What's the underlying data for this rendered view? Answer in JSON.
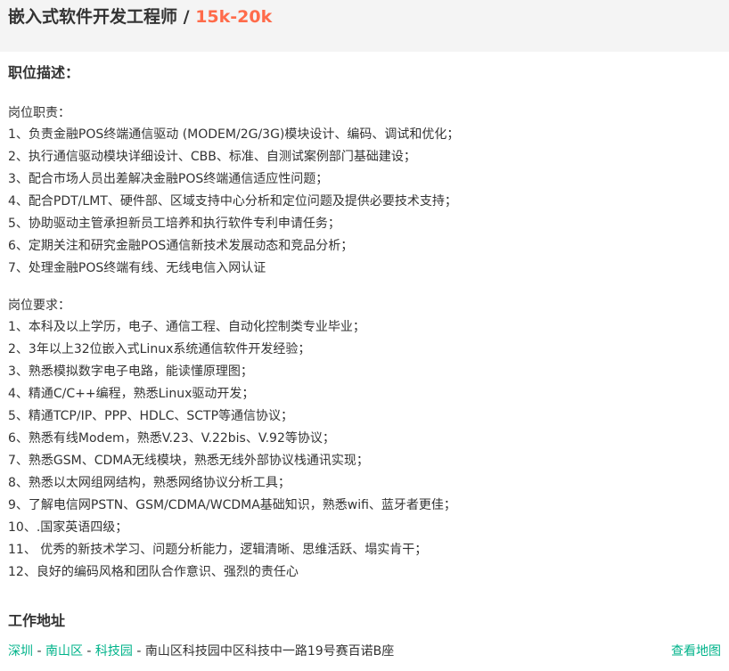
{
  "header": {
    "title": "嵌入式软件开发工程师",
    "separator": " / ",
    "salary": "15k-20k"
  },
  "description": {
    "heading": "职位描述：",
    "duties_label": "岗位职责：",
    "duties": [
      "1、负责金融POS终端通信驱动 (MODEM/2G/3G)模块设计、编码、调试和优化；",
      "2、执行通信驱动模块详细设计、CBB、标准、自测试案例部门基础建设；",
      "3、配合市场人员出差解决金融POS终端通信适应性问题；",
      "4、配合PDT/LMT、硬件部、区域支持中心分析和定位问题及提供必要技术支持；",
      "5、协助驱动主管承担新员工培养和执行软件专利申请任务；",
      "6、定期关注和研究金融POS通信新技术发展动态和竞品分析；",
      "7、处理金融POS终端有线、无线电信入网认证"
    ],
    "requirements_label": "岗位要求：",
    "requirements": [
      "1、本科及以上学历，电子、通信工程、自动化控制类专业毕业；",
      "2、3年以上32位嵌入式Linux系统通信软件开发经验；",
      "3、熟悉模拟数字电子电路，能读懂原理图；",
      "4、精通C/C++编程，熟悉Linux驱动开发；",
      "5、精通TCP/IP、PPP、HDLC、SCTP等通信协议；",
      "6、熟悉有线Modem，熟悉V.23、V.22bis、V.92等协议；",
      "7、熟悉GSM、CDMA无线模块，熟悉无线外部协议栈通讯实现；",
      "8、熟悉以太网组网结构，熟悉网络协议分析工具；",
      "9、了解电信网PSTN、GSM/CDMA/WCDMA基础知识，熟悉wifi、蓝牙者更佳；",
      "10、.国家英语四级；",
      "11、 优秀的新技术学习、问题分析能力，逻辑清晰、思维活跃、塌实肯干；",
      "12、良好的编码风格和团队合作意识、强烈的责任心"
    ]
  },
  "work_address": {
    "heading": "工作地址",
    "city": "深圳",
    "district": "南山区",
    "area": "科技园",
    "dash": " - ",
    "detail": "南山区科技园中区科技中一路19号赛百诺B座",
    "map_link": "查看地图"
  },
  "colors": {
    "accent_green": "#00b38a",
    "salary_orange": "#ff6b4a",
    "header_bg": "#f4f4f4"
  }
}
